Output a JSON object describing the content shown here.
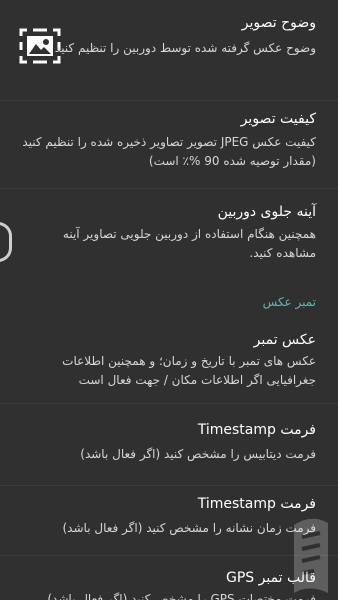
{
  "preferences": [
    {
      "title": "وضوح تصویر",
      "summary": "وضوح عکس گرفته شده توسط دوربین را تنظیم کنید"
    },
    {
      "title": "کیفیت تصویر",
      "summary": "کیفیت عکس JPEG تصویر تصاویر ذخیره شده را تنظیم کنید (مقدار توصیه شده 90 %٪ است)"
    },
    {
      "title": "آینه جلوی دوربین",
      "summary": "همچنین هنگام استفاده از دوربین جلویی تصاویر آینه مشاهده کنید."
    },
    {
      "title": "عکس تمبر",
      "summary": "عکس های تمبر با تاریخ و زمان؛ و همچنین اطلاعات جغرافیایی اگر اطلاعات مکان / جهت فعال است"
    },
    {
      "title": "فرمت Timestamp",
      "summary": "فرمت دیتابیس را مشخص کنید (اگر فعال باشد)"
    },
    {
      "title": "فرمت Timestamp",
      "summary": "فرمت زمان نشانه را مشخص کنید (اگر فعال باشد)"
    },
    {
      "title": "قالب تمبر GPS",
      "summary": "فرمت مختصات GPS را مشخص کنید (اگر فعال باشد)"
    }
  ],
  "section_header": "تمبر عکس",
  "icons": {
    "first_item": "hd-image-icon"
  },
  "colors": {
    "background": "#303030",
    "accent": "#5fb8b0"
  }
}
